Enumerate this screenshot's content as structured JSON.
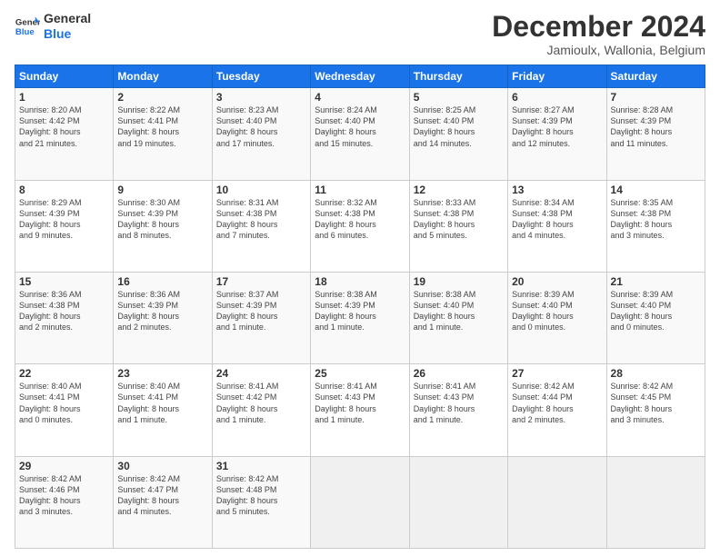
{
  "header": {
    "logo_line1": "General",
    "logo_line2": "Blue",
    "month_title": "December 2024",
    "location": "Jamioulx, Wallonia, Belgium"
  },
  "weekdays": [
    "Sunday",
    "Monday",
    "Tuesday",
    "Wednesday",
    "Thursday",
    "Friday",
    "Saturday"
  ],
  "weeks": [
    [
      {
        "day": "1",
        "lines": [
          "Sunrise: 8:20 AM",
          "Sunset: 4:42 PM",
          "Daylight: 8 hours",
          "and 21 minutes."
        ]
      },
      {
        "day": "2",
        "lines": [
          "Sunrise: 8:22 AM",
          "Sunset: 4:41 PM",
          "Daylight: 8 hours",
          "and 19 minutes."
        ]
      },
      {
        "day": "3",
        "lines": [
          "Sunrise: 8:23 AM",
          "Sunset: 4:40 PM",
          "Daylight: 8 hours",
          "and 17 minutes."
        ]
      },
      {
        "day": "4",
        "lines": [
          "Sunrise: 8:24 AM",
          "Sunset: 4:40 PM",
          "Daylight: 8 hours",
          "and 15 minutes."
        ]
      },
      {
        "day": "5",
        "lines": [
          "Sunrise: 8:25 AM",
          "Sunset: 4:40 PM",
          "Daylight: 8 hours",
          "and 14 minutes."
        ]
      },
      {
        "day": "6",
        "lines": [
          "Sunrise: 8:27 AM",
          "Sunset: 4:39 PM",
          "Daylight: 8 hours",
          "and 12 minutes."
        ]
      },
      {
        "day": "7",
        "lines": [
          "Sunrise: 8:28 AM",
          "Sunset: 4:39 PM",
          "Daylight: 8 hours",
          "and 11 minutes."
        ]
      }
    ],
    [
      {
        "day": "8",
        "lines": [
          "Sunrise: 8:29 AM",
          "Sunset: 4:39 PM",
          "Daylight: 8 hours",
          "and 9 minutes."
        ]
      },
      {
        "day": "9",
        "lines": [
          "Sunrise: 8:30 AM",
          "Sunset: 4:39 PM",
          "Daylight: 8 hours",
          "and 8 minutes."
        ]
      },
      {
        "day": "10",
        "lines": [
          "Sunrise: 8:31 AM",
          "Sunset: 4:38 PM",
          "Daylight: 8 hours",
          "and 7 minutes."
        ]
      },
      {
        "day": "11",
        "lines": [
          "Sunrise: 8:32 AM",
          "Sunset: 4:38 PM",
          "Daylight: 8 hours",
          "and 6 minutes."
        ]
      },
      {
        "day": "12",
        "lines": [
          "Sunrise: 8:33 AM",
          "Sunset: 4:38 PM",
          "Daylight: 8 hours",
          "and 5 minutes."
        ]
      },
      {
        "day": "13",
        "lines": [
          "Sunrise: 8:34 AM",
          "Sunset: 4:38 PM",
          "Daylight: 8 hours",
          "and 4 minutes."
        ]
      },
      {
        "day": "14",
        "lines": [
          "Sunrise: 8:35 AM",
          "Sunset: 4:38 PM",
          "Daylight: 8 hours",
          "and 3 minutes."
        ]
      }
    ],
    [
      {
        "day": "15",
        "lines": [
          "Sunrise: 8:36 AM",
          "Sunset: 4:38 PM",
          "Daylight: 8 hours",
          "and 2 minutes."
        ]
      },
      {
        "day": "16",
        "lines": [
          "Sunrise: 8:36 AM",
          "Sunset: 4:39 PM",
          "Daylight: 8 hours",
          "and 2 minutes."
        ]
      },
      {
        "day": "17",
        "lines": [
          "Sunrise: 8:37 AM",
          "Sunset: 4:39 PM",
          "Daylight: 8 hours",
          "and 1 minute."
        ]
      },
      {
        "day": "18",
        "lines": [
          "Sunrise: 8:38 AM",
          "Sunset: 4:39 PM",
          "Daylight: 8 hours",
          "and 1 minute."
        ]
      },
      {
        "day": "19",
        "lines": [
          "Sunrise: 8:38 AM",
          "Sunset: 4:40 PM",
          "Daylight: 8 hours",
          "and 1 minute."
        ]
      },
      {
        "day": "20",
        "lines": [
          "Sunrise: 8:39 AM",
          "Sunset: 4:40 PM",
          "Daylight: 8 hours",
          "and 0 minutes."
        ]
      },
      {
        "day": "21",
        "lines": [
          "Sunrise: 8:39 AM",
          "Sunset: 4:40 PM",
          "Daylight: 8 hours",
          "and 0 minutes."
        ]
      }
    ],
    [
      {
        "day": "22",
        "lines": [
          "Sunrise: 8:40 AM",
          "Sunset: 4:41 PM",
          "Daylight: 8 hours",
          "and 0 minutes."
        ]
      },
      {
        "day": "23",
        "lines": [
          "Sunrise: 8:40 AM",
          "Sunset: 4:41 PM",
          "Daylight: 8 hours",
          "and 1 minute."
        ]
      },
      {
        "day": "24",
        "lines": [
          "Sunrise: 8:41 AM",
          "Sunset: 4:42 PM",
          "Daylight: 8 hours",
          "and 1 minute."
        ]
      },
      {
        "day": "25",
        "lines": [
          "Sunrise: 8:41 AM",
          "Sunset: 4:43 PM",
          "Daylight: 8 hours",
          "and 1 minute."
        ]
      },
      {
        "day": "26",
        "lines": [
          "Sunrise: 8:41 AM",
          "Sunset: 4:43 PM",
          "Daylight: 8 hours",
          "and 1 minute."
        ]
      },
      {
        "day": "27",
        "lines": [
          "Sunrise: 8:42 AM",
          "Sunset: 4:44 PM",
          "Daylight: 8 hours",
          "and 2 minutes."
        ]
      },
      {
        "day": "28",
        "lines": [
          "Sunrise: 8:42 AM",
          "Sunset: 4:45 PM",
          "Daylight: 8 hours",
          "and 3 minutes."
        ]
      }
    ],
    [
      {
        "day": "29",
        "lines": [
          "Sunrise: 8:42 AM",
          "Sunset: 4:46 PM",
          "Daylight: 8 hours",
          "and 3 minutes."
        ]
      },
      {
        "day": "30",
        "lines": [
          "Sunrise: 8:42 AM",
          "Sunset: 4:47 PM",
          "Daylight: 8 hours",
          "and 4 minutes."
        ]
      },
      {
        "day": "31",
        "lines": [
          "Sunrise: 8:42 AM",
          "Sunset: 4:48 PM",
          "Daylight: 8 hours",
          "and 5 minutes."
        ]
      },
      null,
      null,
      null,
      null
    ]
  ]
}
